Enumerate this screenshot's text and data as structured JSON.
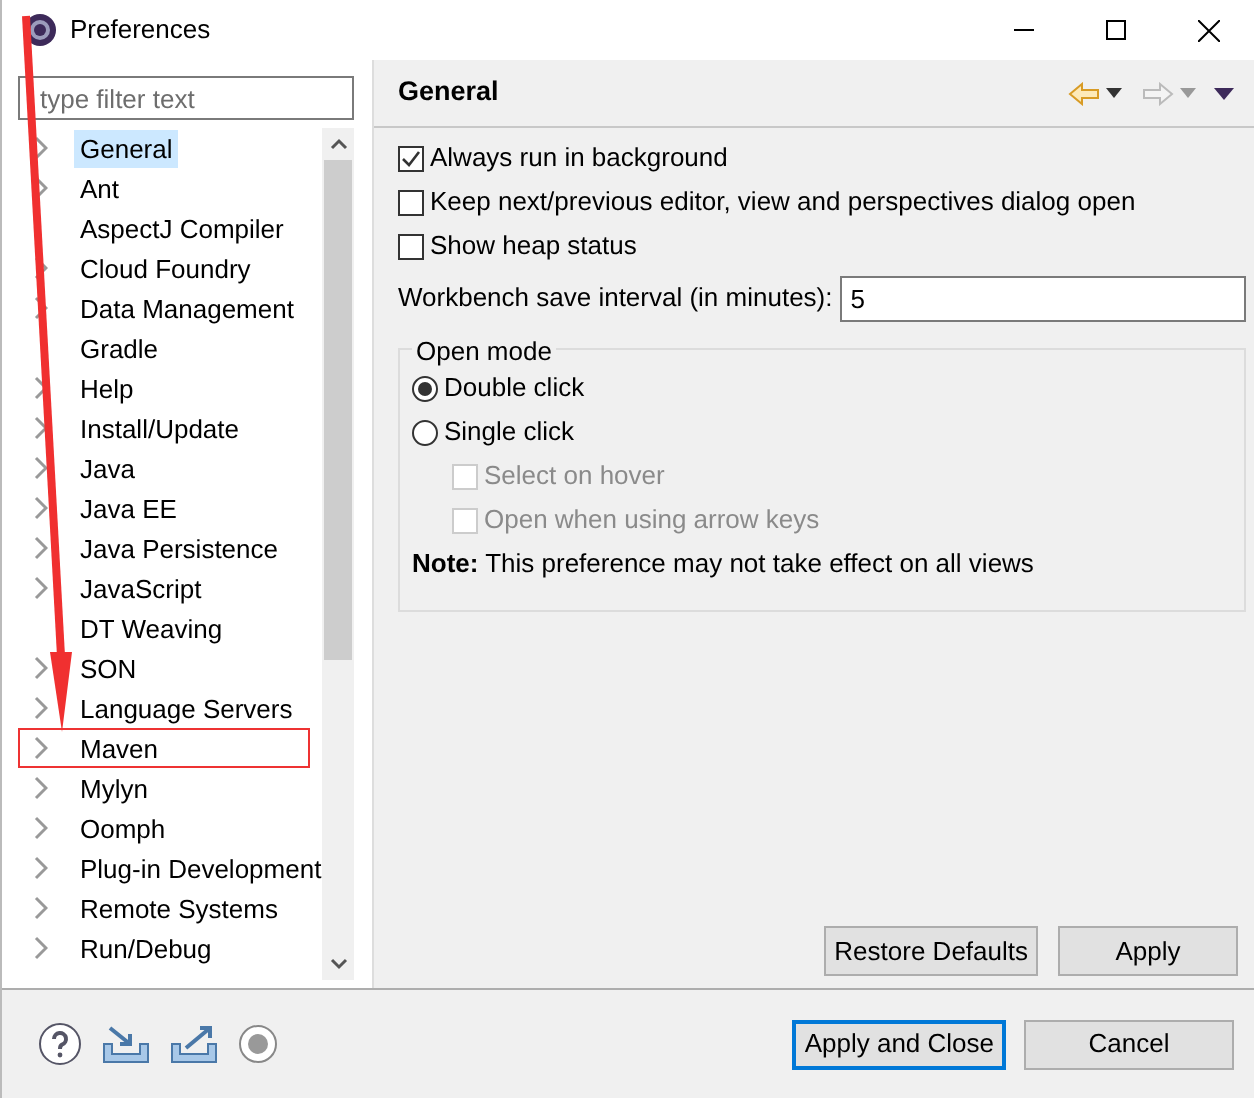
{
  "window": {
    "title": "Preferences"
  },
  "filter": {
    "placeholder": "type filter text"
  },
  "tree": [
    {
      "label": "General",
      "expandable": true,
      "selected": true,
      "highlighted": false
    },
    {
      "label": "Ant",
      "expandable": true,
      "selected": false,
      "highlighted": false
    },
    {
      "label": "AspectJ Compiler",
      "expandable": false,
      "selected": false,
      "highlighted": false
    },
    {
      "label": "Cloud Foundry",
      "expandable": true,
      "selected": false,
      "highlighted": false
    },
    {
      "label": "Data Management",
      "expandable": true,
      "selected": false,
      "highlighted": false
    },
    {
      "label": "Gradle",
      "expandable": false,
      "selected": false,
      "highlighted": false
    },
    {
      "label": "Help",
      "expandable": true,
      "selected": false,
      "highlighted": false
    },
    {
      "label": "Install/Update",
      "expandable": true,
      "selected": false,
      "highlighted": false
    },
    {
      "label": "Java",
      "expandable": true,
      "selected": false,
      "highlighted": false
    },
    {
      "label": "Java EE",
      "expandable": true,
      "selected": false,
      "highlighted": false
    },
    {
      "label": "Java Persistence",
      "expandable": true,
      "selected": false,
      "highlighted": false
    },
    {
      "label": "JavaScript",
      "expandable": true,
      "selected": false,
      "highlighted": false
    },
    {
      "label": "DT Weaving",
      "expandable": false,
      "selected": false,
      "highlighted": false
    },
    {
      "label": "SON",
      "expandable": true,
      "selected": false,
      "highlighted": false
    },
    {
      "label": "Language Servers",
      "expandable": true,
      "selected": false,
      "highlighted": false
    },
    {
      "label": "Maven",
      "expandable": true,
      "selected": false,
      "highlighted": true
    },
    {
      "label": "Mylyn",
      "expandable": true,
      "selected": false,
      "highlighted": false
    },
    {
      "label": "Oomph",
      "expandable": true,
      "selected": false,
      "highlighted": false
    },
    {
      "label": "Plug-in Development",
      "expandable": true,
      "selected": false,
      "highlighted": false
    },
    {
      "label": "Remote Systems",
      "expandable": true,
      "selected": false,
      "highlighted": false
    },
    {
      "label": "Run/Debug",
      "expandable": true,
      "selected": false,
      "highlighted": false
    }
  ],
  "page": {
    "title": "General"
  },
  "options": [
    {
      "label": "Always run in background",
      "checked": true
    },
    {
      "label": "Keep next/previous editor, view and perspectives dialog open",
      "checked": false
    },
    {
      "label": "Show heap status",
      "checked": false
    }
  ],
  "save_interval": {
    "label": "Workbench save interval (in minutes):",
    "value": "5"
  },
  "open_mode": {
    "title": "Open mode",
    "options": [
      {
        "kind": "radio",
        "label": "Double click",
        "selected": true,
        "disabled": false
      },
      {
        "kind": "radio",
        "label": "Single click",
        "selected": false,
        "disabled": false
      },
      {
        "kind": "checkbox",
        "label": "Select on hover",
        "checked": false,
        "disabled": true
      },
      {
        "kind": "checkbox",
        "label": "Open when using arrow keys",
        "checked": false,
        "disabled": true
      }
    ],
    "note": "**Note:** This preference may not take effect on all views"
  },
  "page_buttons": [
    {
      "label": "Restore Defaults"
    },
    {
      "label": "Apply"
    }
  ],
  "dialog_buttons": [
    {
      "label": "Apply and Close",
      "default": true
    },
    {
      "label": "Cancel",
      "default": false
    }
  ],
  "annotation": {
    "arrow": true
  }
}
